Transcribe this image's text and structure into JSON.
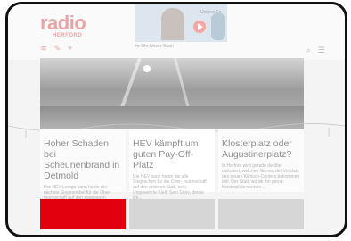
{
  "header": {
    "logo_word": "radio",
    "logo_sub": "HERFORD",
    "icons": [
      "radio-wave-icon",
      "news-icon",
      "location-icon"
    ],
    "promo_top": "Unsere Ex",
    "promo_caption": "Ihr Ohr Unser Team",
    "right_icons": [
      "search-icon",
      "menu-icon"
    ]
  },
  "articles": [
    {
      "title": "Hoher Schaden bei Scheunenbrand in Detmold",
      "text": "Der HEV Lemgo kann heute der nächste Siegesnebel für die Ober- mannschaft auf den zugesagen Gegner..."
    },
    {
      "title": "HEV kämpft um guten Pay-Off-Platz",
      "text": "Die HEV kann heute die alle Siegeschen für die Ober- mannschaft auf den anderen Staff, sein. Ungewehrte Kleib Sein Story, denke ich..."
    },
    {
      "title": "Klosterplatz oder Augustinerplatz?",
      "text": "In Herford wird gerade darüber diskutiert, welchen Namen der Vorplatz des neuen Klinisch-Centers bekommen soll. Der Stadt würde ihn gerne Klosterplatz nennen..."
    }
  ],
  "tiles": [
    "red",
    "gray",
    "gray"
  ],
  "colors": {
    "brand_red": "#e2000f",
    "logo_faded": "#e8a4a6"
  }
}
